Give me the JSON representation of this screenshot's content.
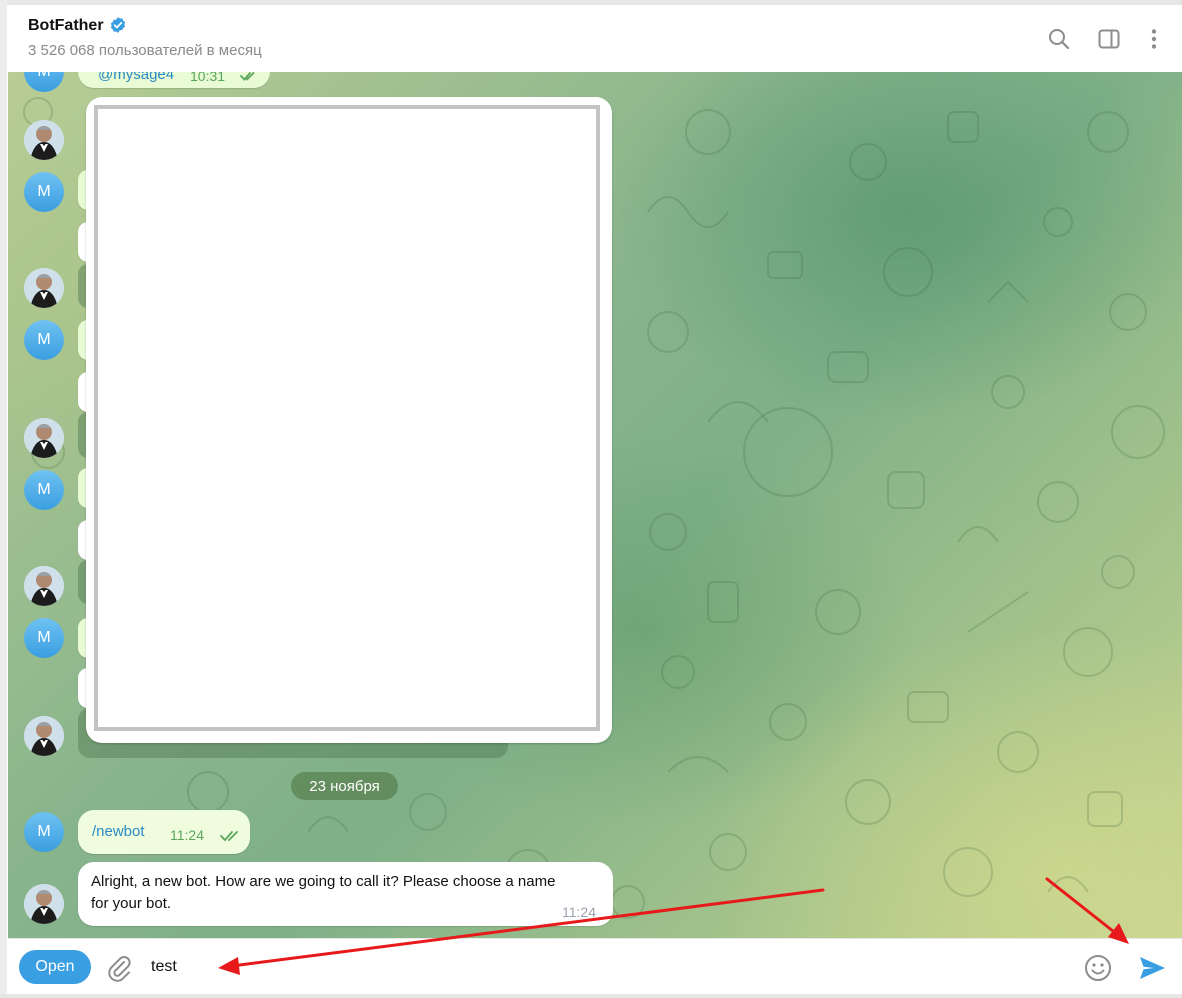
{
  "header": {
    "title": "BotFather",
    "subtitle": "3 526 068 пользователей в месяц"
  },
  "chat": {
    "partial_top": {
      "text": "@mysage4",
      "time": "10:31"
    },
    "date_separator": "23 ноября",
    "messages": [
      {
        "sender": "M",
        "text": "/newbot",
        "time": "11:24",
        "outgoing": true
      },
      {
        "sender": "BotFather",
        "text": "Alright, a new bot. How are we going to call it? Please choose a name for your bot.",
        "time": "11:24",
        "outgoing": false
      }
    ],
    "avatar_initial": "M"
  },
  "composer": {
    "open_label": "Open",
    "input_value": "test"
  },
  "colors": {
    "accent": "#3a9ee2",
    "outgoing_bubble": "#effdde",
    "annotation_arrow": "#e8191a"
  },
  "icons": [
    "verified-icon",
    "search-icon",
    "sidebar-toggle-icon",
    "more-vertical-icon",
    "attach-icon",
    "emoji-icon",
    "send-icon"
  ]
}
